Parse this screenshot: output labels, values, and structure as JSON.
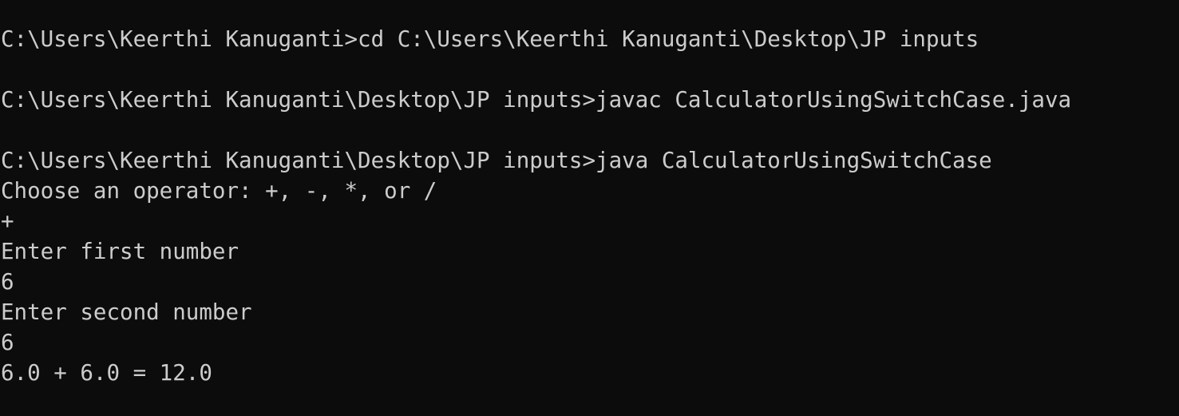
{
  "terminal": {
    "lines": [
      "C:\\Users\\Keerthi Kanuganti>cd C:\\Users\\Keerthi Kanuganti\\Desktop\\JP inputs",
      "C:\\Users\\Keerthi Kanuganti\\Desktop\\JP inputs>javac CalculatorUsingSwitchCase.java",
      "C:\\Users\\Keerthi Kanuganti\\Desktop\\JP inputs>java CalculatorUsingSwitchCase",
      "Choose an operator: +, -, *, or /",
      "+",
      "Enter first number",
      "6",
      "Enter second number",
      "6",
      "6.0 + 6.0 = 12.0"
    ],
    "colors": {
      "background": "#0c0c0c",
      "text": "#cccccc"
    }
  }
}
